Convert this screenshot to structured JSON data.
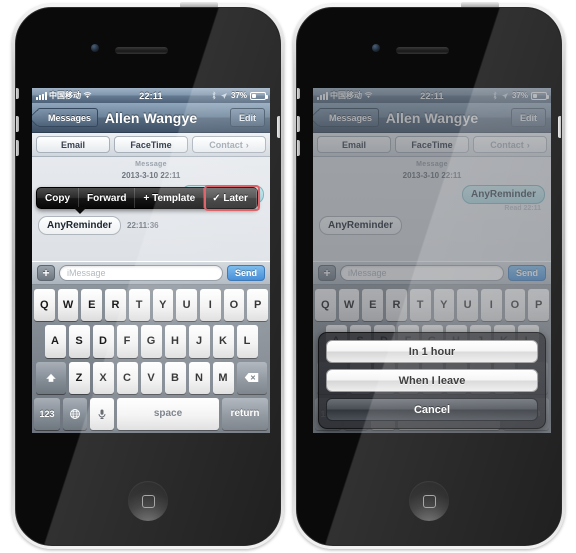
{
  "status_bar": {
    "carrier": "中国移动",
    "time": "22:11",
    "battery_percent": "37%",
    "wifi_icon": "wifi-icon",
    "bluetooth_icon": "bluetooth-icon",
    "location_icon": "location-arrow-icon",
    "signal_icon": "signal-bars-icon",
    "battery_icon": "battery-icon"
  },
  "nav_bar": {
    "back_label": "Messages",
    "title": "Allen Wangye",
    "edit_label": "Edit"
  },
  "sub_toolbar": {
    "email_label": "Email",
    "facetime_label": "FaceTime",
    "contact_label": "Contact",
    "contact_chevron": "chevron-right-icon"
  },
  "conversation": {
    "separator_label": "Message",
    "date_label": "2013-3-10 22:11",
    "sent_bubble_text": "AnyReminder",
    "read_tag": "Read 22:11",
    "received_bubble_text": "AnyReminder",
    "received_bubble_time": "22:11:36"
  },
  "context_menu": {
    "items": [
      {
        "label": "Copy"
      },
      {
        "label": "Forward"
      },
      {
        "label": "+ Template"
      },
      {
        "label": "✓ Later"
      }
    ],
    "highlight_color": "#d94b52",
    "highlighted_index": 3
  },
  "input_bar": {
    "plus_label": "+",
    "placeholder": "iMessage",
    "send_label": "Send",
    "send_color": "#2d7fd4"
  },
  "keyboard": {
    "row1": [
      "Q",
      "W",
      "E",
      "R",
      "T",
      "Y",
      "U",
      "I",
      "O",
      "P"
    ],
    "row2": [
      "A",
      "S",
      "D",
      "F",
      "G",
      "H",
      "J",
      "K",
      "L"
    ],
    "row3": [
      "Z",
      "X",
      "C",
      "V",
      "B",
      "N",
      "M"
    ],
    "shift_icon": "shift-up-arrow-icon",
    "delete_icon": "backspace-delete-icon",
    "numbers_label": "123",
    "globe_icon": "globe-language-icon",
    "mic_icon": "microphone-icon",
    "space_label": "space",
    "return_label": "return"
  },
  "action_sheet": {
    "option_one": "In 1 hour",
    "option_two": "When I leave",
    "cancel_label": "Cancel"
  },
  "device": {
    "home_button": "home-button",
    "camera": "front-camera",
    "speaker": "earpiece-speaker"
  }
}
